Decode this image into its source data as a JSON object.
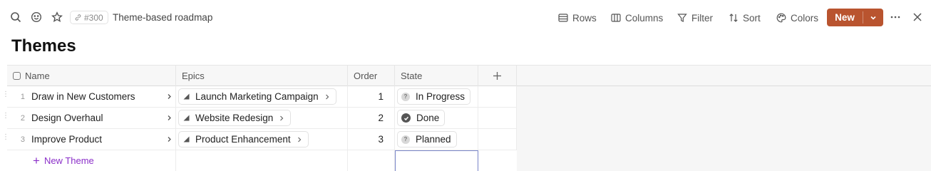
{
  "toolbar": {
    "ref": "#300",
    "breadcrumb": "Theme-based roadmap",
    "rows_label": "Rows",
    "columns_label": "Columns",
    "filter_label": "Filter",
    "sort_label": "Sort",
    "colors_label": "Colors",
    "new_label": "New"
  },
  "page": {
    "title": "Themes"
  },
  "table": {
    "columns": [
      "Name",
      "Epics",
      "Order",
      "State"
    ],
    "rows": [
      {
        "num": "1",
        "name": "Draw in New Customers",
        "epic": "Launch Marketing Campaign",
        "order": "1",
        "state": "In Progress",
        "state_icon": "question-icon"
      },
      {
        "num": "2",
        "name": "Design Overhaul",
        "epic": "Website Redesign",
        "order": "2",
        "state": "Done",
        "state_icon": "check-circle-icon"
      },
      {
        "num": "3",
        "name": "Improve Product",
        "epic": "Product Enhancement",
        "order": "3",
        "state": "Planned",
        "state_icon": "question-icon"
      }
    ],
    "new_row_label": "New Theme"
  },
  "colors": {
    "accent": "#b9542f",
    "new_row": "#8b2fc9",
    "selection": "#7a86c9"
  }
}
